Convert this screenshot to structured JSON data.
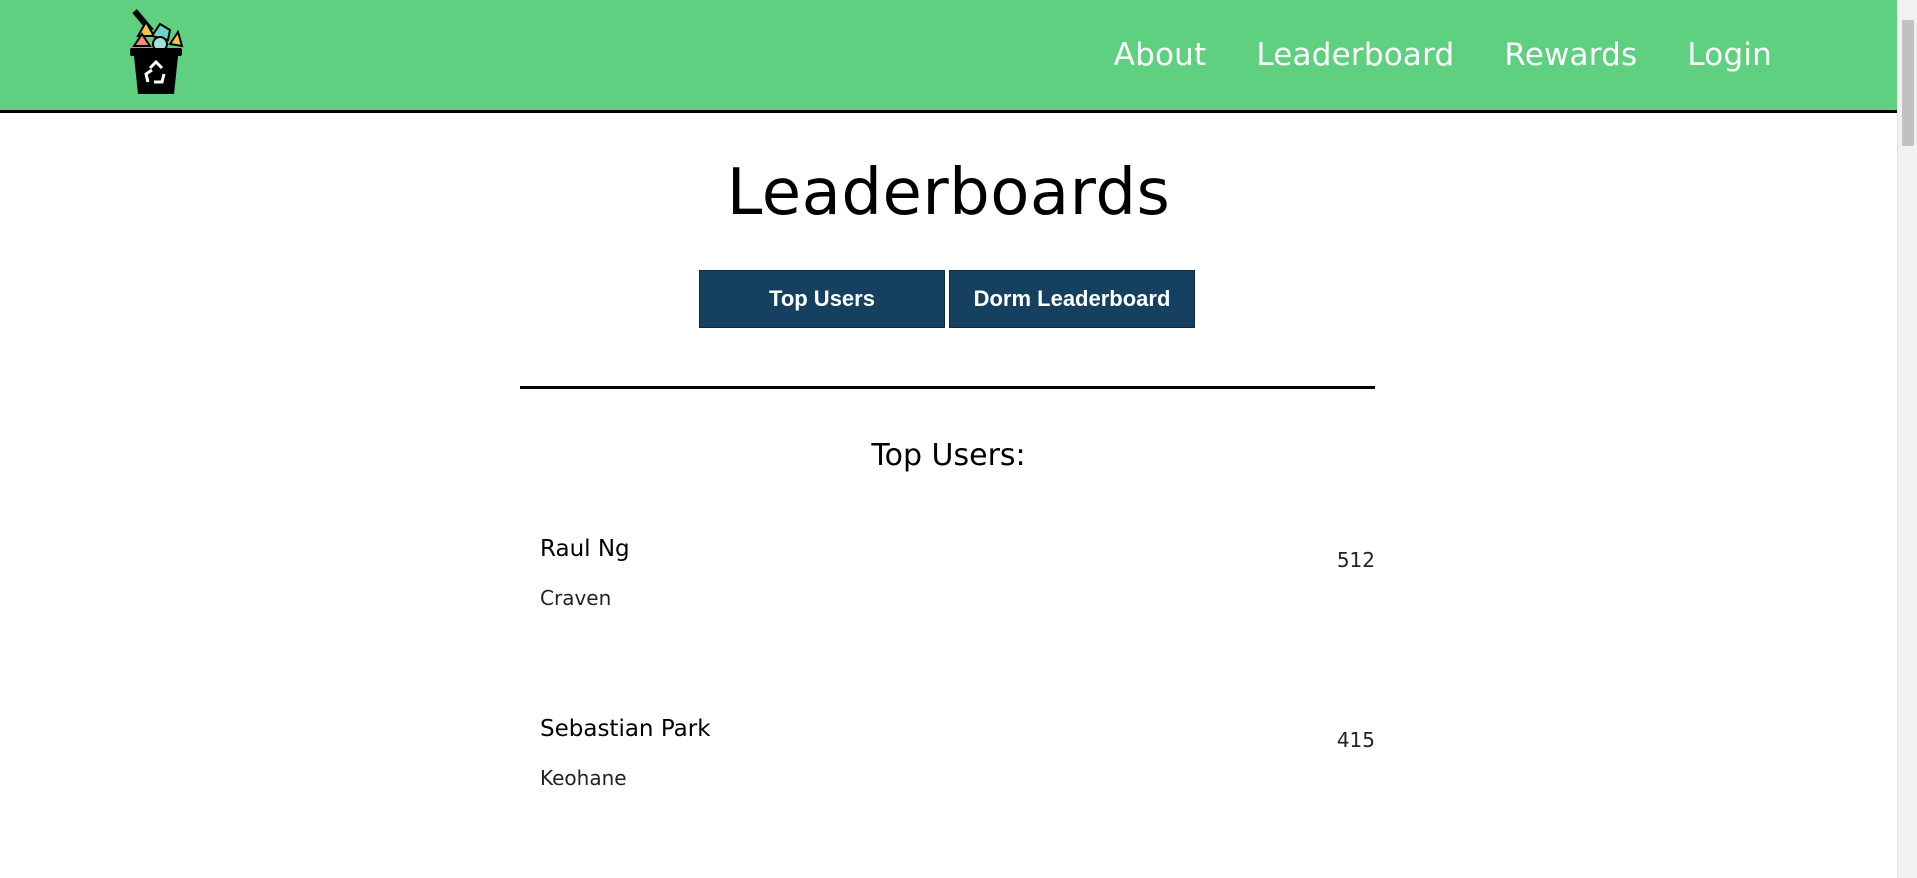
{
  "navbar": {
    "logo_alt": "recycling bin logo",
    "links": [
      "About",
      "Leaderboard",
      "Rewards",
      "Login"
    ],
    "background": "#5fcf80"
  },
  "page": {
    "title": "Leaderboards",
    "tabs": [
      "Top Users",
      "Dorm Leaderboard"
    ],
    "tab_color": "#15405f",
    "section_title": "Top Users:"
  },
  "users": [
    {
      "name": "Raul Ng",
      "dorm": "Craven",
      "score": "512"
    },
    {
      "name": "Sebastian Park",
      "dorm": "Keohane",
      "score": "415"
    }
  ]
}
